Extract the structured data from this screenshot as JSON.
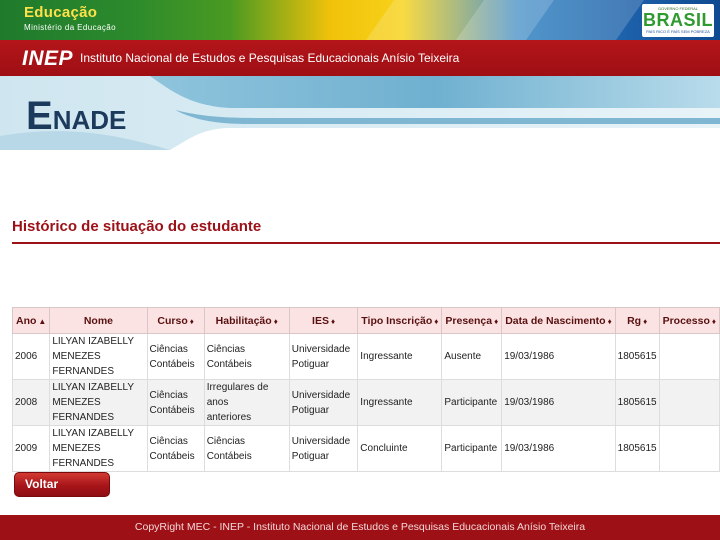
{
  "header": {
    "gov_title": "Educação",
    "gov_subtitle": "Ministério da Educação",
    "brasil_logo": {
      "word": "BRASIL",
      "tagline_top": "GOVERNO FEDERAL",
      "motto": "PAÍS RICO É PAÍS SEM POBREZA"
    },
    "inep_logo": "INEP",
    "inep_name": "Instituto Nacional de Estudos e Pesquisas Educacionais Anísio Teixeira",
    "banner_word_first": "E",
    "banner_word_rest": "NADE",
    "colors": {
      "gov_green": "#1f7a2c",
      "gov_yellow": "#f2c20a",
      "gov_blue": "#1c5fa8",
      "inep_red": "#b3151a"
    }
  },
  "page": {
    "title": "Histórico de situação do estudante",
    "accent": "#9b1117"
  },
  "table": {
    "columns": [
      {
        "label": "Ano",
        "sort": "▲"
      },
      {
        "label": "Nome",
        "sort": ""
      },
      {
        "label": "Curso",
        "sort": "♦"
      },
      {
        "label": "Habilitação",
        "sort": "♦"
      },
      {
        "label": "IES",
        "sort": "♦"
      },
      {
        "label": "Tipo Inscrição",
        "sort": "♦"
      },
      {
        "label": "Presença",
        "sort": "♦"
      },
      {
        "label": "Data de Nascimento",
        "sort": "♦"
      },
      {
        "label": "Rg",
        "sort": "♦"
      },
      {
        "label": "Processo",
        "sort": "♦"
      }
    ],
    "rows": [
      {
        "ano": "2006",
        "nome_l1": "LILYAN IZABELLY MENEZES",
        "nome_l2": "FERNANDES",
        "curso_l1": "Ciências",
        "curso_l2": "Contábeis",
        "habilitacao_l1": "Ciências Contábeis",
        "habilitacao_l2": "",
        "ies_l1": "Universidade",
        "ies_l2": "Potiguar",
        "tipo": "Ingressante",
        "presenca": "Ausente",
        "nascimento": "19/03/1986",
        "rg": "1805615",
        "processo": ""
      },
      {
        "ano": "2008",
        "nome_l1": "LILYAN IZABELLY MENEZES",
        "nome_l2": "FERNANDES",
        "curso_l1": "Ciências",
        "curso_l2": "Contábeis",
        "habilitacao_l1": "Irregulares de anos",
        "habilitacao_l2": "anteriores",
        "ies_l1": "Universidade",
        "ies_l2": "Potiguar",
        "tipo": "Ingressante",
        "presenca": "Participante",
        "nascimento": "19/03/1986",
        "rg": "1805615",
        "processo": ""
      },
      {
        "ano": "2009",
        "nome_l1": "LILYAN IZABELLY MENEZES",
        "nome_l2": "FERNANDES",
        "curso_l1": "Ciências",
        "curso_l2": "Contábeis",
        "habilitacao_l1": "Ciências Contábeis",
        "habilitacao_l2": "",
        "ies_l1": "Universidade",
        "ies_l2": "Potiguar",
        "tipo": "Concluinte",
        "presenca": "Participante",
        "nascimento": "19/03/1986",
        "rg": "1805615",
        "processo": ""
      }
    ]
  },
  "actions": {
    "back_label": "Voltar"
  },
  "footer": {
    "text": "CopyRight MEC - INEP - Instituto Nacional de Estudos e Pesquisas Educacionais Anísio Teixeira"
  }
}
